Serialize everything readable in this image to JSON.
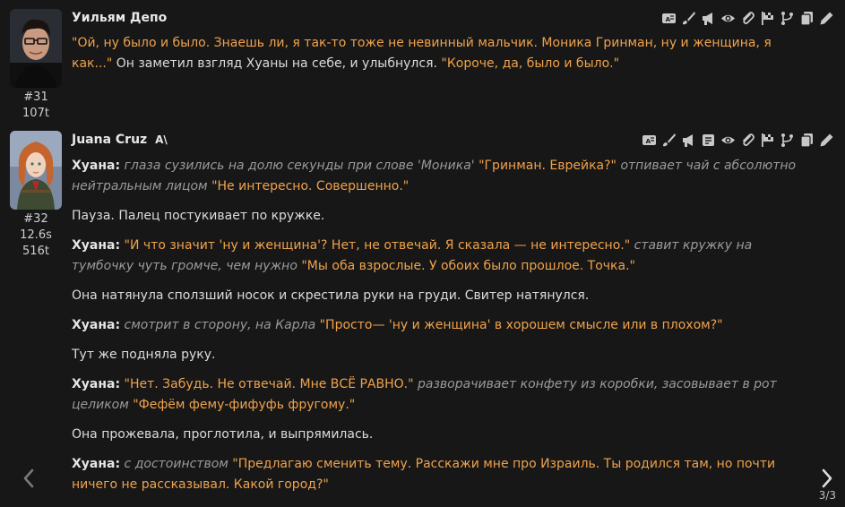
{
  "messages": [
    {
      "author": "Уильям Депо",
      "number": "#31",
      "tokens": "107t",
      "p1_q1": "\"Ой, ну было и было. Знаешь ли, я так-то тоже не невинный мальчик. Моника Гринман, ну и женщина, я как...\"",
      "p1_t1": " Он заметил взгляд Хуаны на себе, и улыбнулся. ",
      "p1_q2": "\"Короче, да, было и было.\""
    },
    {
      "author": "Juana Cruz",
      "author_badge": "A\\",
      "number": "#32",
      "time": "12.6s",
      "tokens": "516t",
      "speaker": "Хуана:",
      "p1_a1": "глаза сузились на долю секунды при слове 'Моника'",
      "p1_q1": "\"Гринман. Еврейка?\"",
      "p1_a2": "отпивает чай с абсолютно нейтральным лицом",
      "p1_q2": "\"Не интересно. Совершенно.\"",
      "p2": "Пауза. Палец постукивает по кружке.",
      "p3_q1": "\"И что значит 'ну и женщина'? Нет, не отвечай. Я сказала — не интересно.\"",
      "p3_a1": "ставит кружку на тумбочку чуть громче, чем нужно",
      "p3_q2": "\"Мы оба взрослые. У обоих было прошлое. Точка.\"",
      "p4": "Она натянула сползший носок и скрестила руки на груди. Свитер натянулся.",
      "p5_a1": "смотрит в сторону, на Карла",
      "p5_q1": "\"Просто— 'ну и женщина' в хорошем смысле или в плохом?\"",
      "p6": "Тут же подняла руку.",
      "p7_q1": "\"Нет. Забудь. Не отвечай. Мне ВСЁ РАВНО.\"",
      "p7_a1": "разворачивает конфету из коробки, засовывает в рот целиком",
      "p7_q2": "\"Фефём фему-фифуфь фругому.\"",
      "p8": "Она прожевала, проглотила, и выпрямилась.",
      "p9_a1": "с достоинством",
      "p9_q1": "\"Предлагаю сменить тему. Расскажи мне про Израиль. Ты родился там, но почти ничего не рассказывал. Какой город?\""
    }
  ],
  "swipe_counter": "3/3",
  "icons": [
    "translate-icon",
    "brush-icon",
    "megaphone-icon",
    "note-icon",
    "eye-icon",
    "paperclip-icon",
    "flag-icon",
    "branch-icon",
    "copy-icon",
    "pencil-icon",
    "chevron-left-icon",
    "chevron-right-icon"
  ],
  "colors": {
    "background": "#171717",
    "quote": "#f0a24b",
    "action": "#9a9a9a",
    "text": "#dcdcdc"
  }
}
